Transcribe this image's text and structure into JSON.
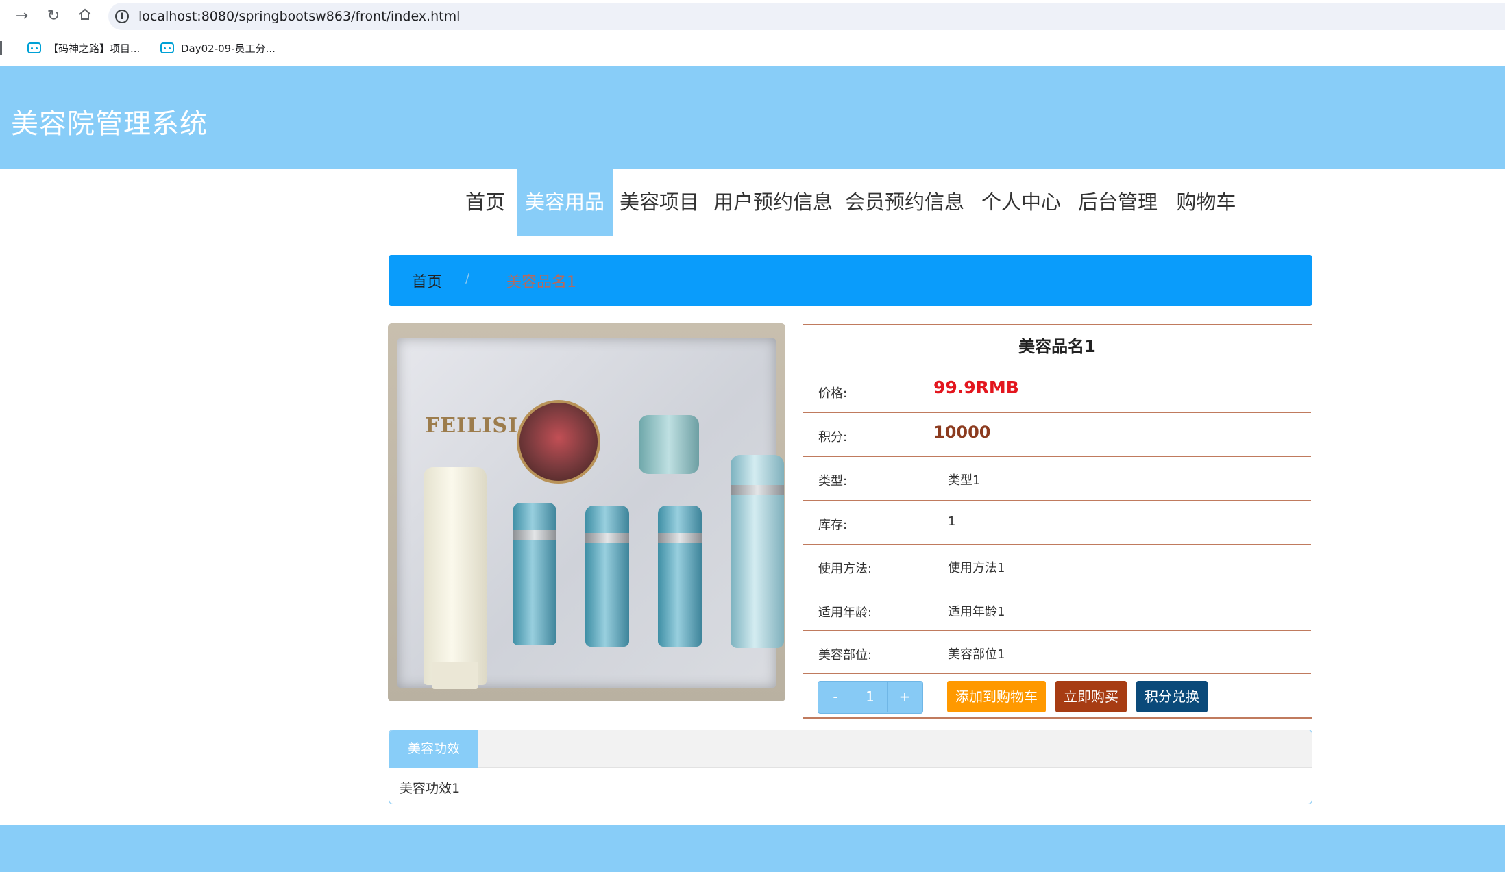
{
  "browser": {
    "url": "localhost:8080/springbootsw863/front/index.html",
    "bookmarks": [
      {
        "label": "【码神之路】项目..."
      },
      {
        "label": "Day02-09-员工分..."
      }
    ]
  },
  "header": {
    "title": "美容院管理系统"
  },
  "nav": {
    "items": [
      {
        "label": "首页"
      },
      {
        "label": "美容用品"
      },
      {
        "label": "美容项目"
      },
      {
        "label": "用户预约信息"
      },
      {
        "label": "会员预约信息"
      },
      {
        "label": "个人中心"
      },
      {
        "label": "后台管理"
      },
      {
        "label": "购物车"
      }
    ],
    "active_index": 1
  },
  "breadcrumb": {
    "home": "首页",
    "separator": "/",
    "current": "美容品名1"
  },
  "product": {
    "name": "美容品名1",
    "image_brand_text": "FEILISI",
    "rows": [
      {
        "label": "价格:",
        "value": "99.9RMB"
      },
      {
        "label": "积分:",
        "value": "10000"
      },
      {
        "label": "类型:",
        "value": "类型1"
      },
      {
        "label": "库存:",
        "value": "1"
      },
      {
        "label": "使用方法:",
        "value": "使用方法1"
      },
      {
        "label": "适用年龄:",
        "value": "适用年龄1"
      },
      {
        "label": "美容部位:",
        "value": "美容部位1"
      }
    ],
    "quantity": {
      "minus": "-",
      "value": "1",
      "plus": "+"
    },
    "buttons": {
      "add_to_cart": "添加到购物车",
      "buy_now": "立即购买",
      "exchange": "积分兑换"
    }
  },
  "tabs": {
    "active_label": "美容功效",
    "content": "美容功效1"
  },
  "colors": {
    "theme": "#88cdf8",
    "breadcrumb": "#0a9cfb",
    "price": "#e3161e",
    "points": "#8c3b1f",
    "cart_button": "#ff9900",
    "buy_button": "#a73c13",
    "exchange_button": "#0b4a7a",
    "border": "#c07b5e"
  }
}
